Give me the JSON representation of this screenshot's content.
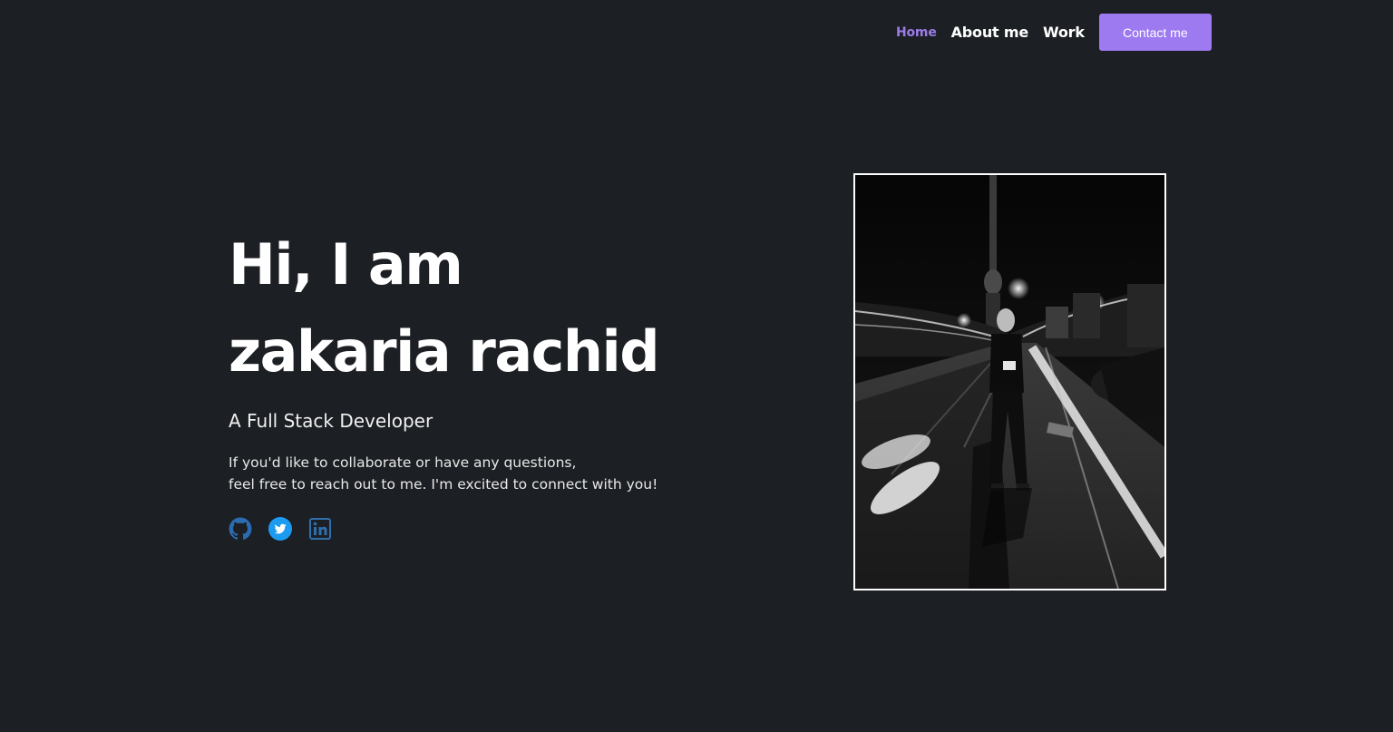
{
  "nav": {
    "items": [
      {
        "label": "Home",
        "active": true
      },
      {
        "label": "About me",
        "active": false
      },
      {
        "label": "Work",
        "active": false
      }
    ],
    "contact_label": "Contact me"
  },
  "hero": {
    "title_line1": "Hi, I am",
    "title_line2": "zakaria rachid",
    "subtitle": "A Full Stack Developer",
    "desc_line1": "If you'd like to collaborate or have any questions,",
    "desc_line2": "feel free to reach out to me. I'm excited to connect with you!"
  },
  "socials": [
    {
      "icon": "github-icon"
    },
    {
      "icon": "twitter-icon"
    },
    {
      "icon": "linkedin-icon"
    }
  ],
  "colors": {
    "background": "#1c1f23",
    "accent": "#9d7af0",
    "active_nav": "#9b7ce8",
    "social_blue": "#1d9bf0",
    "github_blue": "#2b6cb0",
    "linkedin_blue": "#2f6fae"
  }
}
